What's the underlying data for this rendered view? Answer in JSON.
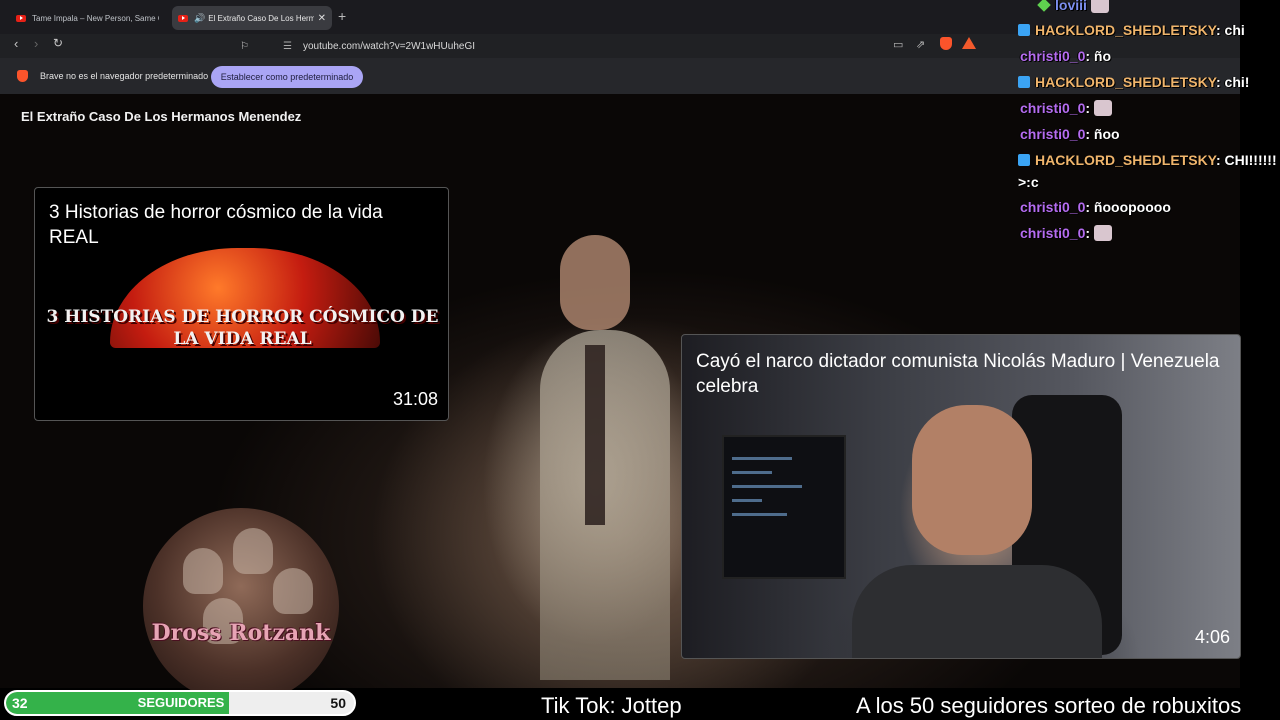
{
  "browser": {
    "tabs": [
      {
        "title": "Tame Impala – New Person, Same Ol",
        "active": false
      },
      {
        "title": "El Extraño Caso De Los Herma",
        "active": true
      }
    ],
    "new_tab_icon": "plus-icon",
    "url": "youtube.com/watch?v=2W1wHUuheGI",
    "infobar_message": "Brave no es el navegador predeterminado",
    "infobar_button": "Establecer como predeterminado"
  },
  "video": {
    "title": "El Extraño Caso De Los Hermanos Menendez"
  },
  "end_cards": [
    {
      "title": "3 Historias de horror cósmico de la vida REAL",
      "thumb_text": "3 HISTORIAS DE HORROR CÓSMICO DE LA VIDA REAL",
      "duration": "31:08"
    },
    {
      "title": "Cayó el narco dictador comunista Nicolás Maduro | Venezuela celebra",
      "duration": "4:06"
    }
  ],
  "avatar_text": "Dross Rotzank",
  "chat": [
    {
      "user": "loviii",
      "text": ""
    },
    {
      "user": "HACKLORD_SHEDLETSKY",
      "text": ": chi"
    },
    {
      "user": "christi0_0",
      "text": ": ño"
    },
    {
      "user": "HACKLORD_SHEDLETSKY",
      "text": ": chi!"
    },
    {
      "user": "christi0_0",
      "text": ":"
    },
    {
      "user": "christi0_0",
      "text": ": ñoo"
    },
    {
      "user": "HACKLORD_SHEDLETSKY",
      "text": ": CHI!!!!!!"
    },
    {
      "user": "",
      "text": ">:c"
    },
    {
      "user": "christi0_0",
      "text": ": ñooopoooo"
    },
    {
      "user": "christi0_0",
      "text": ":"
    }
  ],
  "followers": {
    "current": "32",
    "label": "SEGUIDORES",
    "goal": "50",
    "progress": 0.64
  },
  "tiktok": "Tik Tok: Jottep",
  "ticker": "A los 50 seguidores sorteo de robuxitos",
  "colors": {
    "follow_fill": "#34b24a",
    "chat_user_hack": "#f0b56c",
    "chat_user_christi": "#b56cf0",
    "infobar_button": "#aaa5f5"
  }
}
